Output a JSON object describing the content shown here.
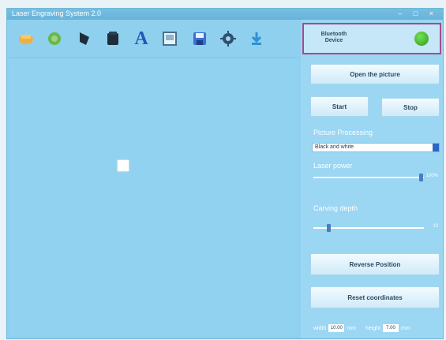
{
  "window": {
    "title": "Laser Engraving System 2.0",
    "controls": "– □ ×"
  },
  "toolbar": {
    "tools": [
      {
        "name": "open-image-tool",
        "icon": "image-icon",
        "color": "#f0b040"
      },
      {
        "name": "frame-tool",
        "icon": "frame-icon",
        "color": "#67b84a"
      },
      {
        "name": "shape-tool",
        "icon": "shape-icon",
        "color": "#1f2d3a"
      },
      {
        "name": "box-tool",
        "icon": "box-icon",
        "color": "#1f2d3a"
      },
      {
        "name": "text-tool",
        "icon": "text-icon",
        "glyph": "A",
        "color": "#2557b8"
      },
      {
        "name": "image-edit-tool",
        "icon": "picture-icon",
        "color": "#4a6f8c"
      },
      {
        "name": "save-tool",
        "icon": "save-icon",
        "color": "#3c6fd0"
      },
      {
        "name": "settings-tool",
        "icon": "gear-icon",
        "color": "#2f4f6b"
      },
      {
        "name": "download-tool",
        "icon": "download-icon",
        "color": "#2e8fd6"
      }
    ]
  },
  "status": {
    "label": "Bluetooth Device",
    "led_color": "#3ab02a"
  },
  "panel": {
    "open_button": "Open the picture",
    "start_button": "Start",
    "stop_button": "Stop",
    "picture_processing_label": "Picture Processing",
    "picture_processing_value": "Black and white",
    "laser_power_label": "Laser power",
    "laser_power_value": "100%",
    "carving_depth_label": "Carving depth",
    "carving_depth_value": "10",
    "reverse_button": "Reverse Position",
    "reset_button": "Reset coordinates",
    "width_label": "width",
    "width_value": "10.00",
    "width_unit": "mm",
    "height_label": "height",
    "height_value": "7.00",
    "height_unit": "mm"
  },
  "levels": {
    "laser_power": 0.97,
    "carving_depth": 0.12
  }
}
